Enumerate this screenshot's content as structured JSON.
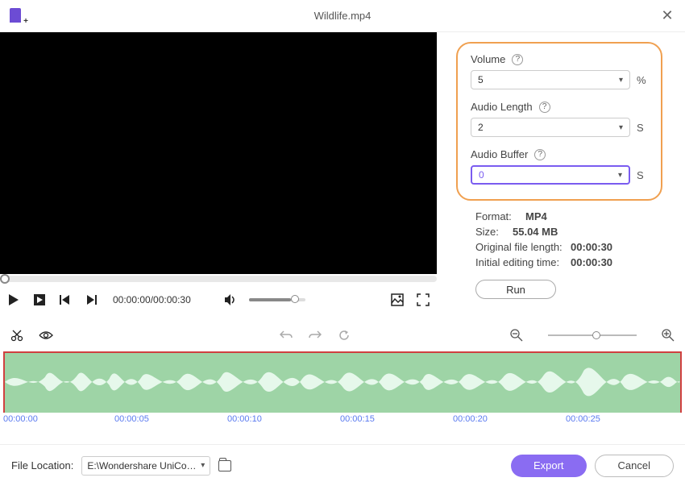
{
  "header": {
    "title": "Wildlife.mp4"
  },
  "settings": {
    "volume_label": "Volume",
    "volume_value": "5",
    "volume_unit": "%",
    "audio_length_label": "Audio Length",
    "audio_length_value": "2",
    "audio_length_unit": "S",
    "audio_buffer_label": "Audio Buffer",
    "audio_buffer_value": "0",
    "audio_buffer_unit": "S"
  },
  "info": {
    "format_label": "Format:",
    "format_value": "MP4",
    "size_label": "Size:",
    "size_value": "55.04 MB",
    "orig_len_label": "Original file length:",
    "orig_len_value": "00:00:30",
    "init_time_label": "Initial editing time:",
    "init_time_value": "00:00:30"
  },
  "run_label": "Run",
  "playback": {
    "timecode": "00:00:00/00:00:30"
  },
  "timeline": {
    "t0": "00:00:00",
    "t1": "00:00:05",
    "t2": "00:00:10",
    "t3": "00:00:15",
    "t4": "00:00:20",
    "t5": "00:00:25"
  },
  "footer": {
    "location_label": "File Location:",
    "location_value": "E:\\Wondershare UniConverter",
    "export_label": "Export",
    "cancel_label": "Cancel"
  }
}
